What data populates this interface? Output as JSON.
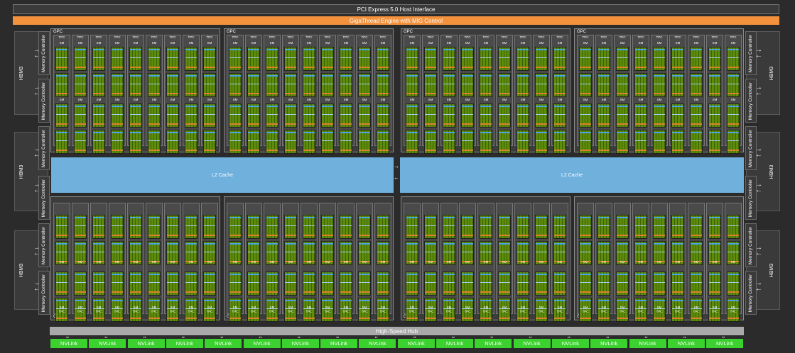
{
  "pcie_label": "PCI Express 5.0 Host Interface",
  "giga_label": "GigaThread Engine with MIG Control",
  "hub_label": "High-Speed Hub",
  "l2_label": "L2 Cache",
  "hbm_label": "HBM3",
  "mc_label": "Memory Controller",
  "gpc_label": "GPC",
  "tpc_label": "TPC",
  "sm_label": "SM",
  "nvlink_label": "NVLink",
  "nvlink_count": 18,
  "colors": {
    "nvlink": "#3bd12e",
    "l2": "#6fb0dd",
    "giga": "#f3913c",
    "hub": "#a9a9a9",
    "sm_green": "#5e8d0b"
  }
}
